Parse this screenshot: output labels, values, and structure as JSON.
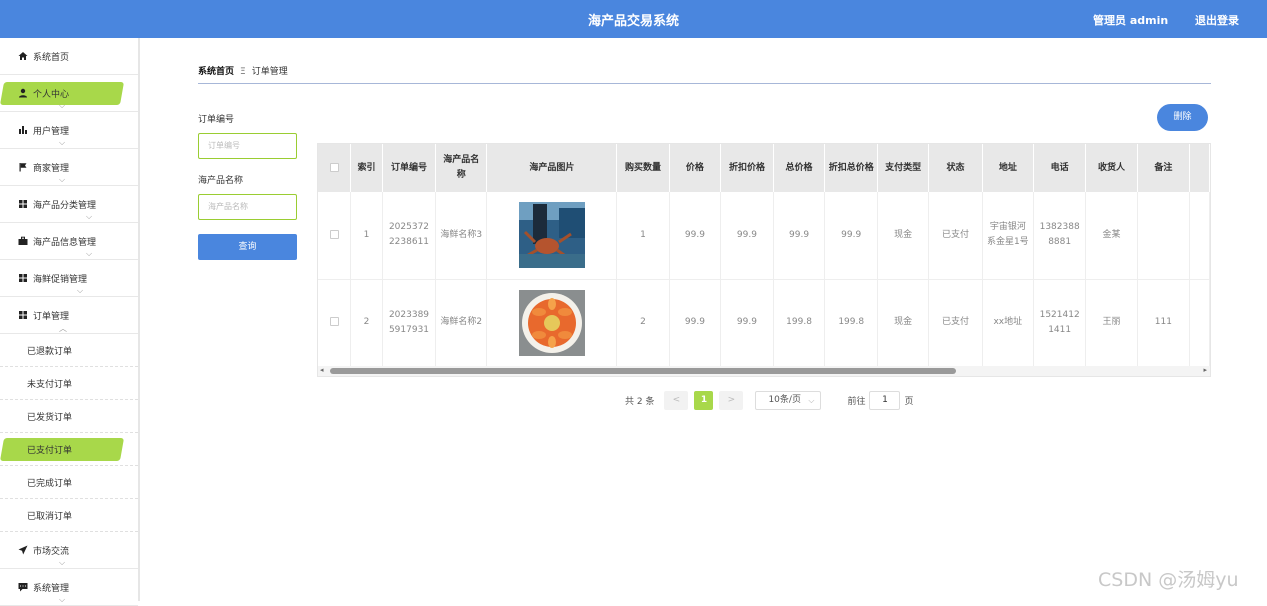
{
  "header": {
    "title": "海产品交易系统",
    "admin_label": "管理员 admin",
    "logout_label": "退出登录",
    "bg_color": "#4a86de"
  },
  "sidebar": {
    "active_color": "#a8d84a",
    "items": [
      {
        "label": "系统首页",
        "icon": "home-icon"
      },
      {
        "label": "个人中心",
        "icon": "user-icon"
      },
      {
        "label": "用户管理",
        "icon": "bar-chart-icon"
      },
      {
        "label": "商家管理",
        "icon": "flag-icon"
      },
      {
        "label": "海产品分类管理",
        "icon": "grid-icon"
      },
      {
        "label": "海产品信息管理",
        "icon": "briefcase-icon"
      },
      {
        "label": "海鲜促销管理",
        "icon": "grid-icon"
      },
      {
        "label": "订单管理",
        "icon": "grid-icon"
      }
    ],
    "sub_items": [
      "已退款订单",
      "未支付订单",
      "已发货订单",
      "已支付订单",
      "已完成订单",
      "已取消订单"
    ],
    "bottom_items": [
      {
        "label": "市场交流",
        "icon": "send-icon"
      },
      {
        "label": "系统管理",
        "icon": "message-icon"
      }
    ]
  },
  "breadcrumb": {
    "home": "系统首页",
    "current": "订单管理"
  },
  "search": {
    "order_no_label": "订单编号",
    "order_no_placeholder": "订单编号",
    "product_label": "海产品名称",
    "product_placeholder": "海产品名称",
    "query_label": "查询"
  },
  "delete_label": "删除",
  "table": {
    "headers": [
      "索引",
      "订单编号",
      "海产品名称",
      "海产品图片",
      "购买数量",
      "价格",
      "折扣价格",
      "总价格",
      "折扣总价格",
      "支付类型",
      "状态",
      "地址",
      "电话",
      "收货人",
      "备注"
    ],
    "rows": [
      {
        "index": "1",
        "order_no": "20253722238611",
        "name": "海鲜名称3",
        "image": "crab-photo",
        "qty": "1",
        "price": "99.9",
        "discount_price": "99.9",
        "total": "99.9",
        "discount_total": "99.9",
        "pay_type": "现金",
        "status": "已支付",
        "address": "宇宙银河系金星1号",
        "phone": "13823888881",
        "receiver": "金某",
        "remark": ""
      },
      {
        "index": "2",
        "order_no": "20233895917931",
        "name": "海鲜名称2",
        "image": "crawfish-plate-photo",
        "qty": "2",
        "price": "99.9",
        "discount_price": "99.9",
        "total": "199.8",
        "discount_total": "199.8",
        "pay_type": "现金",
        "status": "已支付",
        "address": "xx地址",
        "phone": "15214121411",
        "receiver": "王丽",
        "remark": "111"
      }
    ]
  },
  "pagination": {
    "total_text": "共 2 条",
    "prev": "<",
    "current_page": "1",
    "next": ">",
    "page_size": "10条/页",
    "goto_prefix": "前往",
    "goto_value": "1",
    "goto_suffix": "页"
  },
  "watermark": "CSDN @汤姆yu"
}
